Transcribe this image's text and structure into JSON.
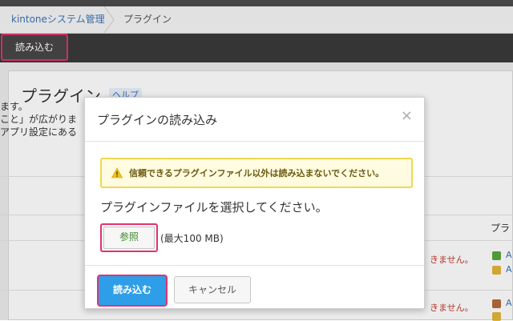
{
  "breadcrumb": {
    "items": [
      "kintoneシステム管理",
      "プラグイン"
    ]
  },
  "toolbar": {
    "import_label": "読み込む"
  },
  "background": {
    "page_title": "プラグイン",
    "help_link": "ヘルプ",
    "text_lines": [
      "ます。",
      "こと」が広がりま",
      "アプリ設定にある"
    ],
    "warning_fragment": "きません。",
    "column_header": "プラ",
    "link_char": "A"
  },
  "dialog": {
    "title": "プラグインの読み込み",
    "close_symbol": "×",
    "alert_text": "信頼できるプラグインファイル以外は読み込まないでください。",
    "instruction": "プラグインファイルを選択してください。",
    "browse_label": "参照",
    "size_note": "(最大100 MB)",
    "import_label": "読み込む",
    "cancel_label": "キャンセル"
  },
  "colors": {
    "accent_highlight": "#e0336f",
    "primary_button": "#2f9ee8",
    "link": "#3b74b9",
    "alert_border": "#f0d84f"
  }
}
